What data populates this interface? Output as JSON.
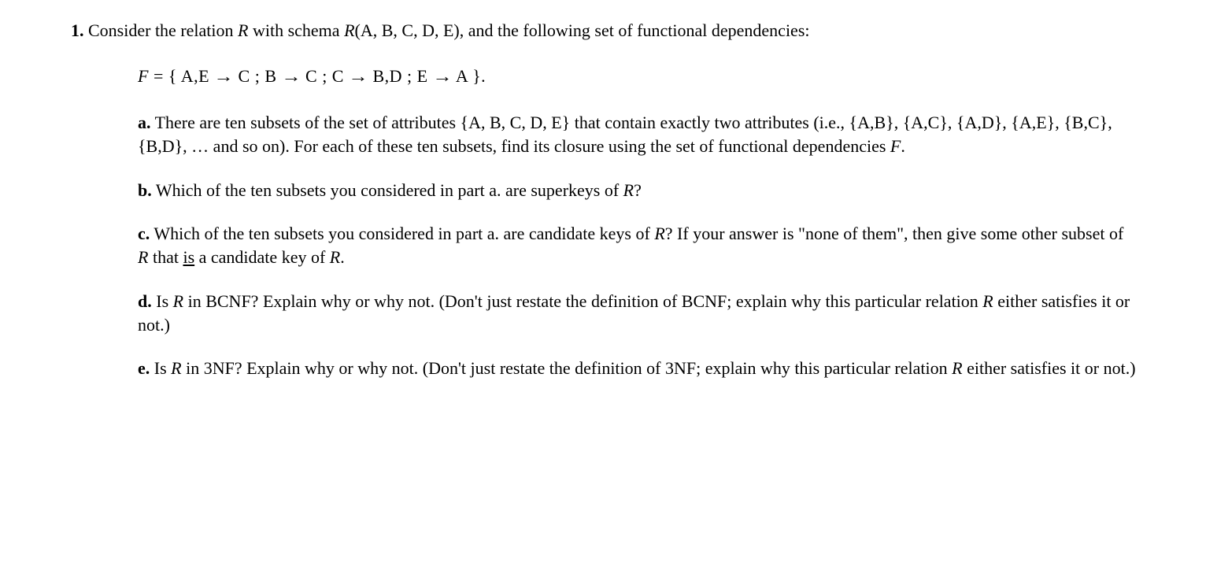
{
  "question": {
    "number": "1.",
    "intro_prefix": "Consider the relation ",
    "intro_R": "R",
    "intro_mid": " with schema ",
    "intro_schema": "R",
    "intro_schema_args": "(A, B, C, D, E), and the following set of functional dependencies:",
    "formula": {
      "F": "F",
      "eq": " = {  A,E ",
      "arr": "→",
      "p1b": " C  ;  B ",
      "p2b": " C  ;  C ",
      "p3b": " B,D  ;  E ",
      "p4b": " A  }."
    },
    "parts": {
      "a": {
        "label": "a.",
        "text1": " There are ten subsets of the set of attributes {A, B, C, D, E} that contain exactly two attributes (i.e., {A,B}, {A,C}, {A,D}, {A,E}, {B,C}, {B,D}, … and  so on).  For each of these ten subsets, find its closure using the set of functional dependencies ",
        "F": "F",
        "end": "."
      },
      "b": {
        "label": "b.",
        "text1": " Which of the ten subsets you considered in part a. are superkeys of ",
        "R": "R",
        "q": "?"
      },
      "c": {
        "label": "c.",
        "text1": " Which of the ten subsets you considered in part a. are candidate keys of ",
        "R1": "R",
        "text2": "?  If your answer is \"none of them\", then give some other subset of ",
        "R2": "R",
        "text3": " that ",
        "is": "is",
        "text4": " a candidate key of ",
        "R3": "R",
        "end": "."
      },
      "d": {
        "label": "d.",
        "text1": " Is ",
        "R1": "R",
        "text2": " in BCNF?  Explain why or why not.  (Don't just restate the definition of BCNF; explain why this particular relation ",
        "R2": "R",
        "text3": " either satisfies it or not.)"
      },
      "e": {
        "label": "e.",
        "text1": " Is ",
        "R1": "R",
        "text2": " in 3NF?  Explain why or why not.  (Don't just restate the definition of 3NF; explain why this particular relation ",
        "R2": "R",
        "text3": " either satisfies it or not.)"
      }
    }
  }
}
